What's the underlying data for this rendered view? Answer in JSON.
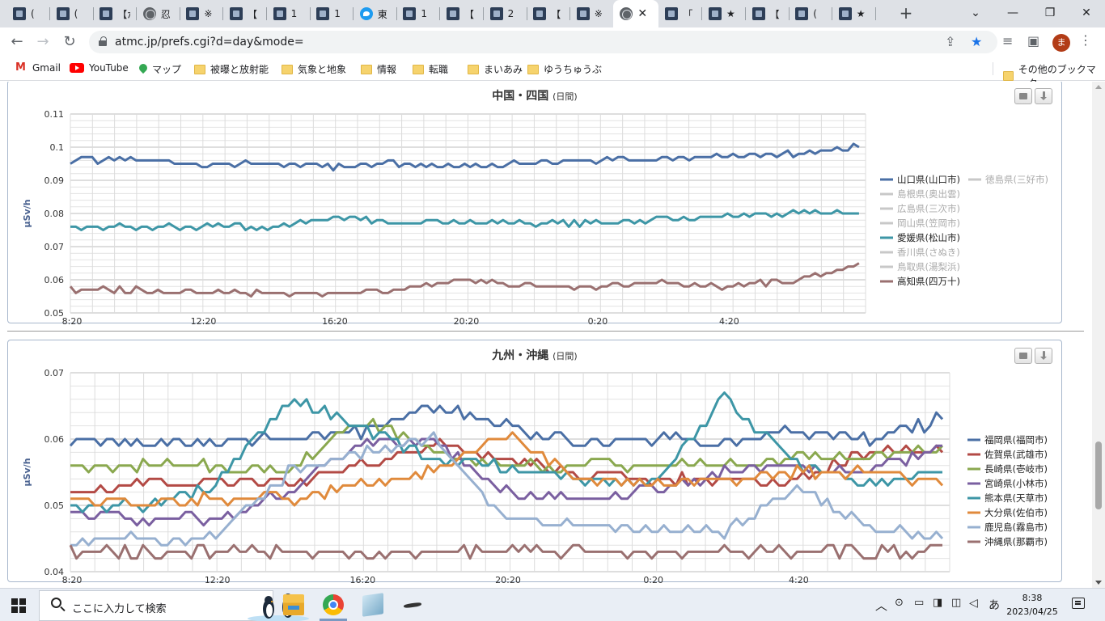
{
  "browser": {
    "tabs": [
      {
        "label": "(",
        "icon": "site"
      },
      {
        "label": "(",
        "icon": "site"
      },
      {
        "label": "【が",
        "icon": "site"
      },
      {
        "label": "忍",
        "icon": "globe"
      },
      {
        "label": "※",
        "icon": "site"
      },
      {
        "label": "【",
        "icon": "site"
      },
      {
        "label": "1",
        "icon": "site"
      },
      {
        "label": "1",
        "icon": "site"
      },
      {
        "label": "東",
        "icon": "twitter"
      },
      {
        "label": "1",
        "icon": "site"
      },
      {
        "label": "【",
        "icon": "site"
      },
      {
        "label": "2",
        "icon": "site"
      },
      {
        "label": "【",
        "icon": "site"
      },
      {
        "label": "※",
        "icon": "site"
      },
      {
        "label": "",
        "icon": "globe",
        "active": true
      },
      {
        "label": "「",
        "icon": "site"
      },
      {
        "label": "★",
        "icon": "site"
      },
      {
        "label": "【",
        "icon": "site"
      },
      {
        "label": "(",
        "icon": "site"
      },
      {
        "label": "★",
        "icon": "site"
      }
    ],
    "active_close": "✕",
    "new_tab": "+",
    "window_controls": {
      "chevron": "⌄",
      "minimize": "—",
      "restore": "❐",
      "close": "✕"
    },
    "nav": {
      "back": "←",
      "forward": "→",
      "reload": "↻"
    },
    "url": "atmc.jp/prefs.cgi?d=day&mode=",
    "toolbar_icons": {
      "share": "⇪",
      "star": "★",
      "media": "≡",
      "sidepanel": "▣",
      "profile": "ま",
      "menu": "⋮"
    },
    "bookmarks": [
      {
        "label": "Gmail",
        "icon": "gmail"
      },
      {
        "label": "YouTube",
        "icon": "youtube"
      },
      {
        "label": "マップ",
        "icon": "maps"
      },
      {
        "label": "被曝と放射能",
        "icon": "folder"
      },
      {
        "label": "気象と地象",
        "icon": "folder"
      },
      {
        "label": "情報",
        "icon": "folder"
      },
      {
        "label": "転職",
        "icon": "folder"
      },
      {
        "label": "まいあみ",
        "icon": "folder"
      },
      {
        "label": "ゆうちゅうぶ",
        "icon": "folder"
      }
    ],
    "other_bookmarks": "その他のブックマーク"
  },
  "charts": {
    "top": {
      "title": "中国・四国",
      "subtitle": "(日間)",
      "ylabel": "µSv/h",
      "yticks": [
        "0.11",
        "0.1",
        "0.09",
        "0.08",
        "0.07",
        "0.06",
        "0.05"
      ],
      "xticks": [
        "8:20",
        "12:20",
        "16:20",
        "20:20",
        "0:20",
        "4:20"
      ],
      "legend_col1": [
        "山口県(山口市)",
        "島根県(奥出雲)",
        "広島県(三次市)",
        "岡山県(笠岡市)",
        "愛媛県(松山市)",
        "香川県(さぬき)",
        "鳥取県(湯梨浜)",
        "高知県(四万十)"
      ],
      "legend_col2": [
        "徳島県(三好市)"
      ]
    },
    "bottom": {
      "title": "九州・沖縄",
      "subtitle": "(日間)",
      "ylabel": "µSv/h",
      "yticks": [
        "0.07",
        "0.06",
        "0.05",
        "0.04"
      ],
      "xticks": [
        "8:20",
        "12:20",
        "16:20",
        "20:20",
        "0:20",
        "4:20"
      ],
      "legend": [
        "福岡県(福岡市)",
        "佐賀県(武雄市)",
        "長崎県(壱岐市)",
        "宮崎県(小林市)",
        "熊本県(天草市)",
        "大分県(佐伯市)",
        "鹿児島(霧島市)",
        "沖縄県(那覇市)"
      ]
    }
  },
  "chart_data": [
    {
      "type": "line",
      "title": "中国・四国",
      "subtitle": "(日間)",
      "ylabel": "µSv/h",
      "ylim": [
        0.05,
        0.11
      ],
      "grid": true,
      "legend_position": "right",
      "x": [
        "8:20",
        "10:20",
        "12:20",
        "14:20",
        "16:20",
        "18:20",
        "20:20",
        "22:20",
        "0:20",
        "2:20",
        "4:20",
        "6:20",
        "8:00"
      ],
      "series": [
        {
          "name": "山口県(山口市)",
          "color": "#4a6fa5",
          "visible": true,
          "values": [
            0.096,
            0.096,
            0.095,
            0.095,
            0.094,
            0.095,
            0.094,
            0.095,
            0.096,
            0.097,
            0.097,
            0.098,
            0.1
          ]
        },
        {
          "name": "島根県(奥出雲)",
          "color": "#c8c8c8",
          "visible": false
        },
        {
          "name": "広島県(三次市)",
          "color": "#c8c8c8",
          "visible": false
        },
        {
          "name": "岡山県(笠岡市)",
          "color": "#c8c8c8",
          "visible": false
        },
        {
          "name": "愛媛県(松山市)",
          "color": "#3d96a6",
          "visible": true,
          "values": [
            0.076,
            0.076,
            0.076,
            0.076,
            0.079,
            0.077,
            0.078,
            0.077,
            0.077,
            0.078,
            0.079,
            0.08,
            0.08
          ]
        },
        {
          "name": "香川県(さぬき)",
          "color": "#c8c8c8",
          "visible": false
        },
        {
          "name": "鳥取県(湯梨浜)",
          "color": "#c8c8c8",
          "visible": false
        },
        {
          "name": "高知県(四万十)",
          "color": "#9a7070",
          "visible": true,
          "values": [
            0.057,
            0.057,
            0.056,
            0.056,
            0.056,
            0.057,
            0.06,
            0.058,
            0.058,
            0.059,
            0.058,
            0.06,
            0.064
          ]
        },
        {
          "name": "徳島県(三好市)",
          "color": "#c8c8c8",
          "visible": false
        }
      ]
    },
    {
      "type": "line",
      "title": "九州・沖縄",
      "subtitle": "(日間)",
      "ylabel": "µSv/h",
      "ylim": [
        0.04,
        0.07
      ],
      "grid": true,
      "legend_position": "right",
      "x": [
        "8:20",
        "10:20",
        "12:20",
        "14:20",
        "16:20",
        "18:20",
        "20:20",
        "22:20",
        "0:20",
        "2:20",
        "4:20",
        "6:20",
        "8:00"
      ],
      "series": [
        {
          "name": "福岡県(福岡市)",
          "color": "#4a6fa5",
          "visible": true,
          "values": [
            0.06,
            0.059,
            0.06,
            0.06,
            0.061,
            0.065,
            0.062,
            0.059,
            0.06,
            0.06,
            0.061,
            0.06,
            0.063
          ]
        },
        {
          "name": "佐賀県(武雄市)",
          "color": "#b34a45",
          "visible": true,
          "values": [
            0.052,
            0.053,
            0.054,
            0.053,
            0.056,
            0.059,
            0.057,
            0.055,
            0.054,
            0.054,
            0.054,
            0.058,
            0.059
          ]
        },
        {
          "name": "長崎県(壱岐市)",
          "color": "#8aa84f",
          "visible": true,
          "values": [
            0.056,
            0.056,
            0.056,
            0.055,
            0.063,
            0.058,
            0.056,
            0.056,
            0.056,
            0.056,
            0.057,
            0.057,
            0.059
          ]
        },
        {
          "name": "宮崎県(小林市)",
          "color": "#7a5fa0",
          "visible": true,
          "values": [
            0.049,
            0.048,
            0.048,
            0.052,
            0.059,
            0.06,
            0.052,
            0.051,
            0.052,
            0.055,
            0.056,
            0.055,
            0.059
          ]
        },
        {
          "name": "熊本県(天草市)",
          "color": "#3d96a6",
          "visible": true,
          "values": [
            0.05,
            0.05,
            0.053,
            0.066,
            0.062,
            0.057,
            0.056,
            0.054,
            0.053,
            0.066,
            0.056,
            0.053,
            0.055
          ]
        },
        {
          "name": "大分県(佐伯市)",
          "color": "#e08a3c",
          "visible": true,
          "values": [
            0.051,
            0.05,
            0.051,
            0.051,
            0.053,
            0.055,
            0.061,
            0.054,
            0.053,
            0.054,
            0.055,
            0.055,
            0.053
          ]
        },
        {
          "name": "鹿児島(霧島市)",
          "color": "#97b0d0",
          "visible": true,
          "values": [
            0.044,
            0.045,
            0.045,
            0.055,
            0.058,
            0.06,
            0.048,
            0.047,
            0.046,
            0.046,
            0.053,
            0.047,
            0.045
          ]
        },
        {
          "name": "沖縄県(那覇市)",
          "color": "#9a7070",
          "visible": true,
          "values": [
            0.043,
            0.043,
            0.043,
            0.043,
            0.043,
            0.043,
            0.043,
            0.043,
            0.043,
            0.043,
            0.043,
            0.043,
            0.043
          ]
        }
      ]
    }
  ],
  "taskbar": {
    "search_placeholder": "ここに入力して検索",
    "time": "8:38",
    "date": "2023/04/25",
    "tray": {
      "chevron": "︿",
      "ime": "あ"
    }
  }
}
